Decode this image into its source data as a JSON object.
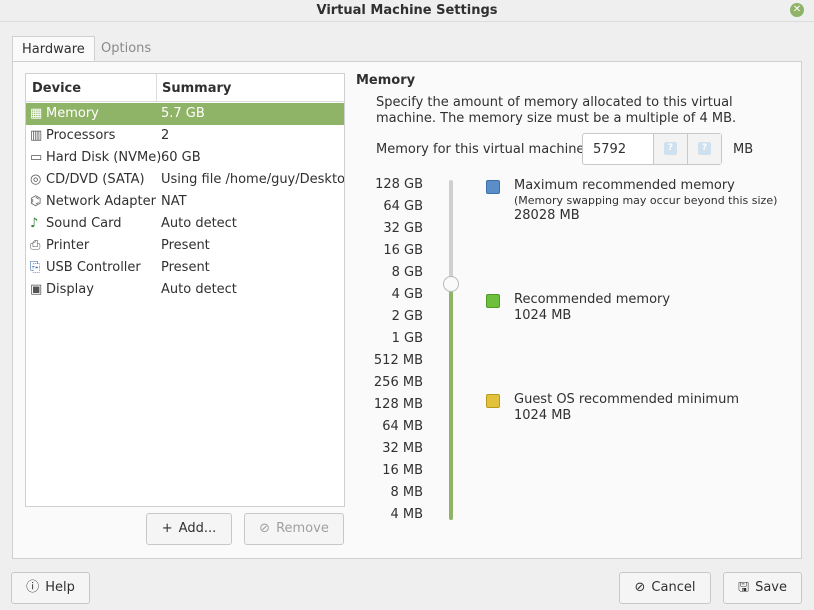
{
  "window": {
    "title": "Virtual Machine Settings"
  },
  "tabs": [
    {
      "label": "Hardware"
    },
    {
      "label": "Options"
    }
  ],
  "device_list": {
    "headers": {
      "device": "Device",
      "summary": "Summary"
    },
    "rows": [
      {
        "name": "Memory",
        "summary": "5.7 GB",
        "icon": "memory-icon",
        "selected": true
      },
      {
        "name": "Processors",
        "summary": "2",
        "icon": "processor-icon"
      },
      {
        "name": "Hard Disk (NVMe)",
        "summary": "60 GB",
        "icon": "hard-disk-icon"
      },
      {
        "name": "CD/DVD (SATA)",
        "summary": "Using file /home/guy/Desktop",
        "icon": "cd-dvd-icon"
      },
      {
        "name": "Network Adapter",
        "summary": "NAT",
        "icon": "network-icon"
      },
      {
        "name": "Sound Card",
        "summary": "Auto detect",
        "icon": "sound-card-icon"
      },
      {
        "name": "Printer",
        "summary": "Present",
        "icon": "printer-icon"
      },
      {
        "name": "USB Controller",
        "summary": "Present",
        "icon": "usb-icon"
      },
      {
        "name": "Display",
        "summary": "Auto detect",
        "icon": "display-icon"
      }
    ]
  },
  "buttons": {
    "add": "Add...",
    "remove": "Remove",
    "help": "Help",
    "cancel": "Cancel",
    "save": "Save"
  },
  "memory": {
    "title": "Memory",
    "description": "Specify the amount of memory allocated to this virtual machine. The memory size must be a multiple of 4 MB.",
    "field_label": "Memory for this virtual machine:",
    "value": "5792",
    "unit": "MB",
    "scale": [
      "128 GB",
      "64 GB",
      "32 GB",
      "16 GB",
      "8 GB",
      "4 GB",
      "2 GB",
      "1 GB",
      "512 MB",
      "256 MB",
      "128 MB",
      "64 MB",
      "32 MB",
      "16 MB",
      "8 MB",
      "4 MB"
    ],
    "slider_level": "5792 MB",
    "legend": [
      {
        "title": "Maximum recommended memory",
        "note": "(Memory swapping may occur beyond this size)",
        "value": "28028 MB",
        "color": "#5b8ec9"
      },
      {
        "title": "Recommended memory",
        "value": "1024 MB",
        "color": "#6fbf3f"
      },
      {
        "title": "Guest OS recommended minimum",
        "value": "1024 MB",
        "color": "#e2c23a"
      }
    ]
  },
  "colors": {
    "accent": "#8fb367"
  }
}
